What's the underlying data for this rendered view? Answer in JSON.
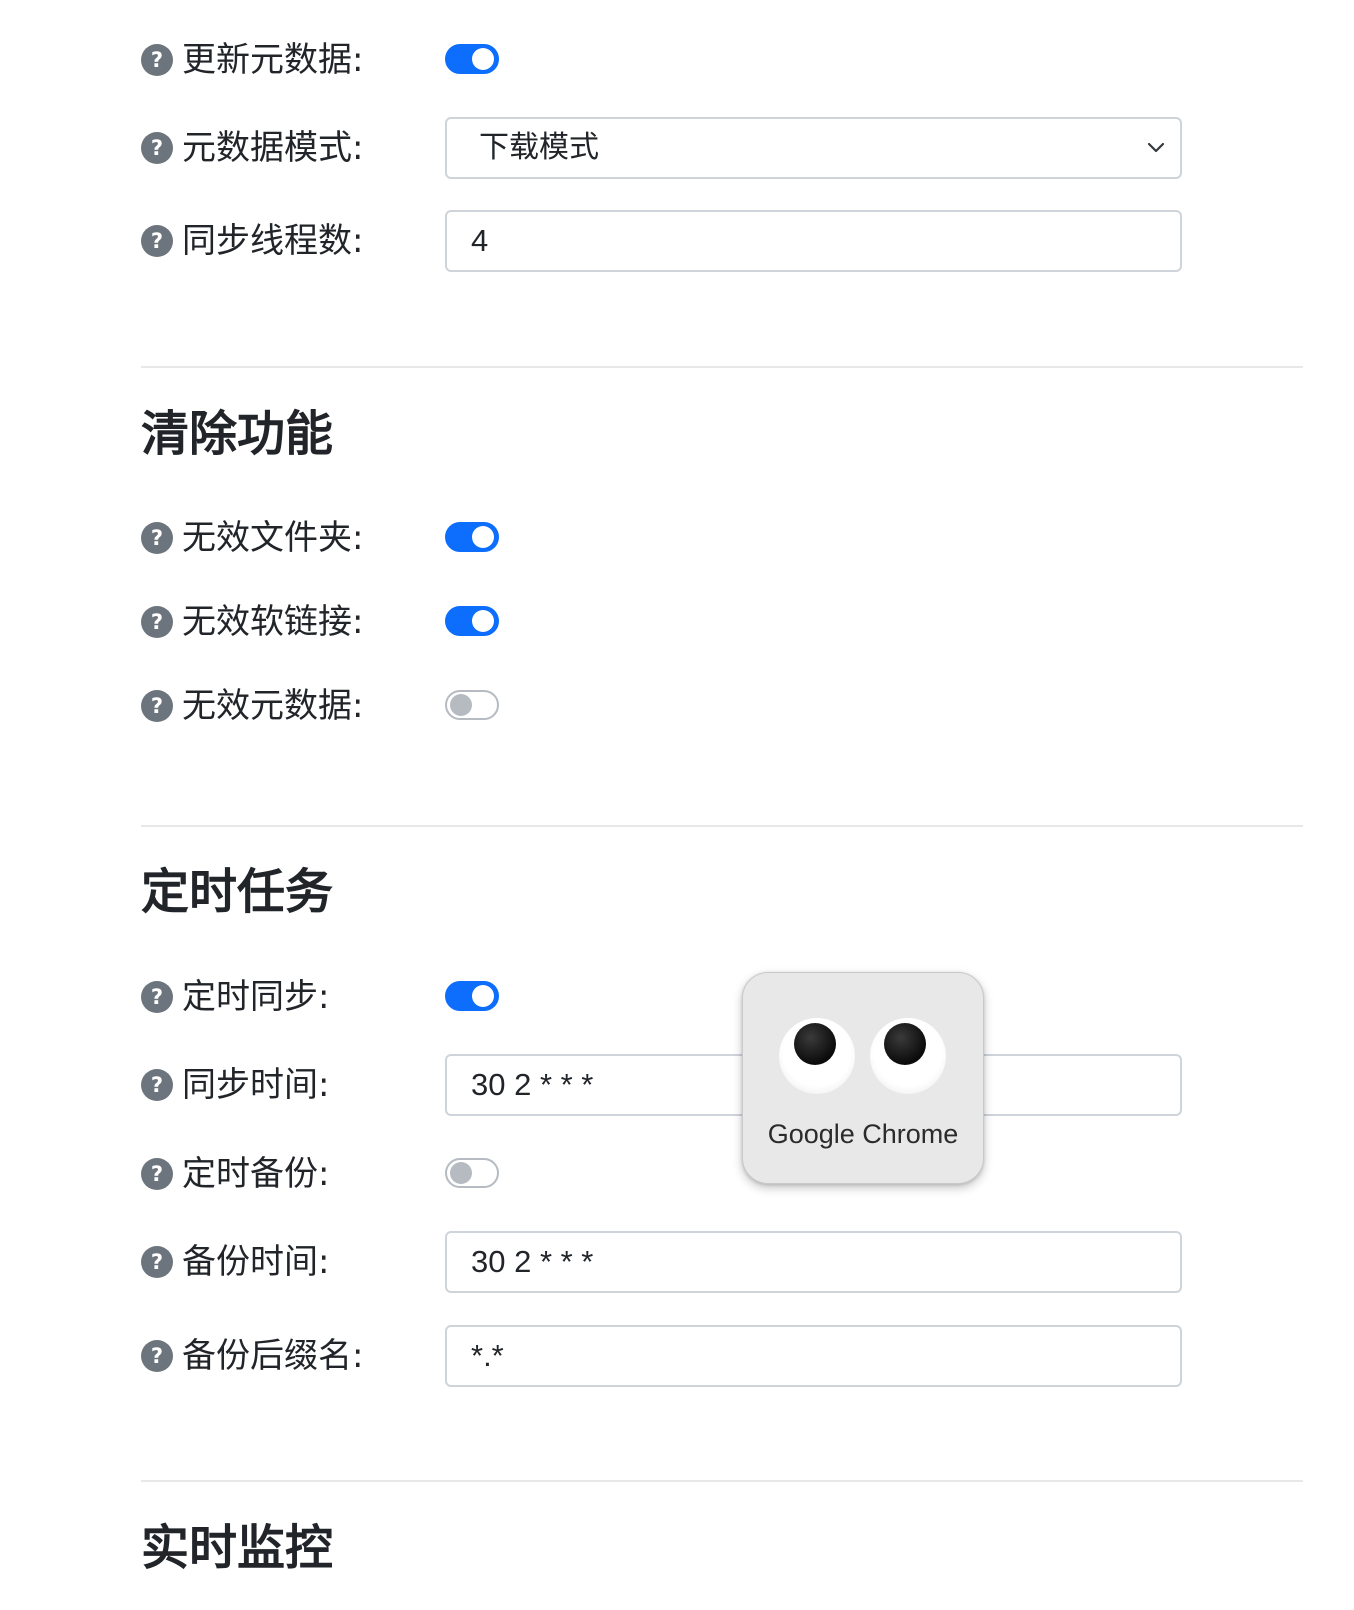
{
  "metadata_section": {
    "update_metadata": {
      "label": "更新元数据:",
      "enabled": true
    },
    "metadata_mode": {
      "label": "元数据模式:",
      "value": "下载模式"
    },
    "sync_threads": {
      "label": "同步线程数:",
      "value": "4"
    }
  },
  "cleanup": {
    "title": "清除功能",
    "invalid_folders": {
      "label": "无效文件夹:",
      "enabled": true
    },
    "invalid_symlinks": {
      "label": "无效软链接:",
      "enabled": true
    },
    "invalid_metadata": {
      "label": "无效元数据:",
      "enabled": false
    }
  },
  "scheduled": {
    "title": "定时任务",
    "scheduled_sync": {
      "label": "定时同步:",
      "enabled": true
    },
    "sync_time": {
      "label": "同步时间:",
      "value": "30 2 * * *"
    },
    "scheduled_backup": {
      "label": "定时备份:",
      "enabled": false
    },
    "backup_time": {
      "label": "备份时间:",
      "value": "30 2 * * *"
    },
    "backup_suffix": {
      "label": "备份后缀名:",
      "value": "*.*"
    }
  },
  "realtime": {
    "title": "实时监控"
  },
  "help_icon_glyph": "?",
  "popup": {
    "title": "Google Chrome"
  },
  "colors": {
    "accent": "#0d6efd",
    "help_icon": "#6c757d",
    "toggle_off": "#b5bbc1",
    "text": "#212529"
  }
}
